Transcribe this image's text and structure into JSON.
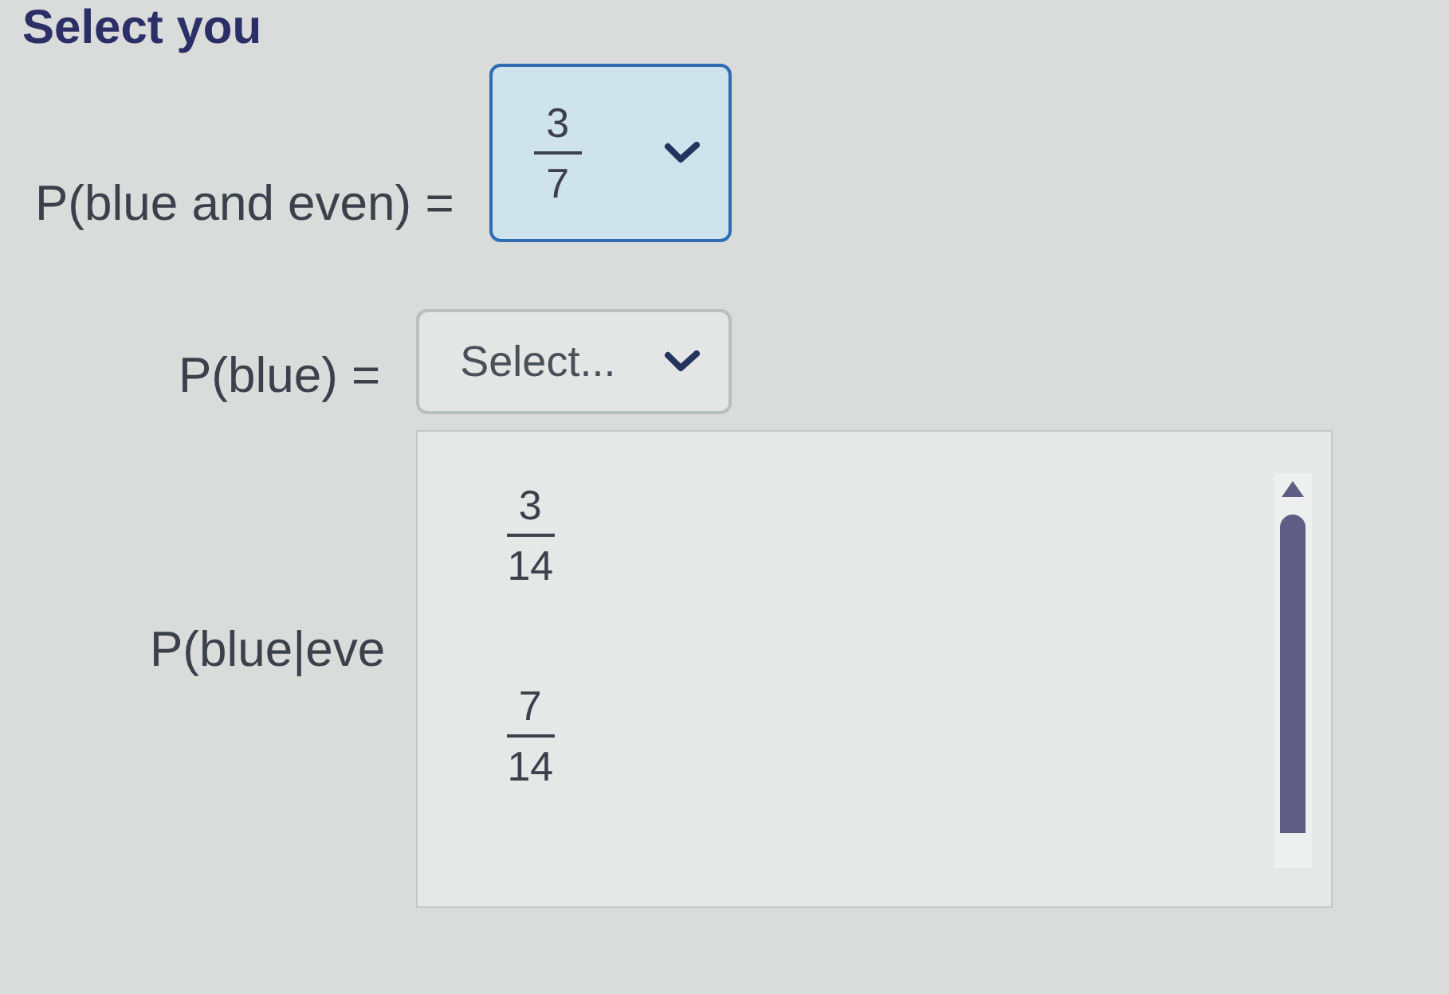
{
  "title": "Select you",
  "questions": [
    {
      "label": "P(blue and even) =",
      "dropdown": {
        "answered": true,
        "expanded": false,
        "value": {
          "numerator": "3",
          "denominator": "7"
        }
      }
    },
    {
      "label": "P(blue) =",
      "dropdown": {
        "answered": false,
        "expanded": true,
        "placeholder": "Select...",
        "options": [
          {
            "numerator": "3",
            "denominator": "14",
            "selected": false
          },
          {
            "numerator": "7",
            "denominator": "14",
            "selected": false
          }
        ]
      }
    },
    {
      "label": "P(blue|eve"
    }
  ]
}
